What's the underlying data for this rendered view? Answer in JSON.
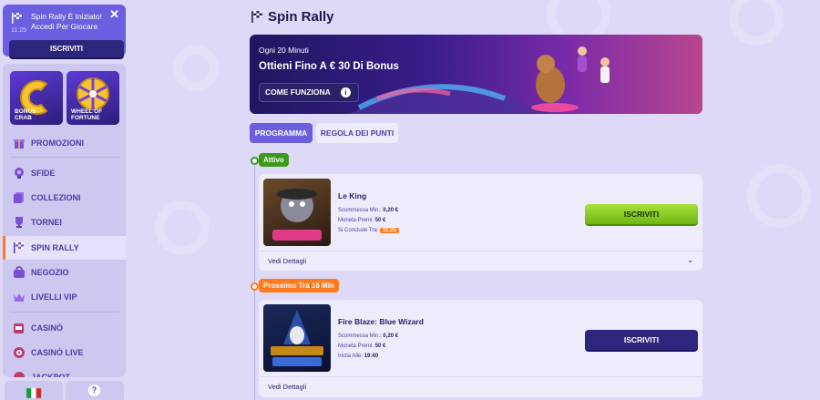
{
  "notification": {
    "message": "Spin Rally È Iniziato! Accedi Per Giocare",
    "time": "11:25",
    "button_label": "ISCRIVITI"
  },
  "sidebar": {
    "tiles": [
      {
        "label_line1": "BONUS",
        "label_line2": "CRAB",
        "icon": "crab-claw-icon"
      },
      {
        "label_line1": "WHEEL OF",
        "label_line2": "FORTUNE",
        "icon": "fortune-wheel-icon"
      }
    ],
    "items": [
      {
        "label": "PROMOZIONI",
        "icon": "gift-icon"
      },
      {
        "label": "SFIDE",
        "icon": "challenge-icon"
      },
      {
        "label": "COLLEZIONI",
        "icon": "collection-icon"
      },
      {
        "label": "TORNEI",
        "icon": "trophy-icon"
      },
      {
        "label": "SPIN RALLY",
        "icon": "checkered-flag-icon",
        "active": true
      },
      {
        "label": "NEGOZIO",
        "icon": "shop-icon"
      },
      {
        "label": "LIVELLI VIP",
        "icon": "crown-icon"
      },
      {
        "label": "CASINÒ",
        "icon": "slot-machine-icon"
      },
      {
        "label": "CASINÒ LIVE",
        "icon": "roulette-icon"
      },
      {
        "label": "JACKPOT",
        "icon": "jackpot-icon"
      }
    ],
    "footer": {
      "language_icon": "italy-flag-icon",
      "help_icon": "help-icon",
      "help_label": "?"
    }
  },
  "page": {
    "title": "Spin Rally",
    "title_icon": "checkered-flag-icon"
  },
  "hero": {
    "subtitle": "Ogni 20 Minuti",
    "headline": "Ottieni Fino A € 30 Di Bonus",
    "button_label": "COME FUNZIONA",
    "info_label": "i"
  },
  "tabs": [
    {
      "label": "PROGRAMMA",
      "active": true
    },
    {
      "label": "REGOLA DEI PUNTI",
      "active": false
    }
  ],
  "colors": {
    "accent": "#6b5fe0",
    "active_status": "#3a9a1a",
    "next_status": "#ff7a1a",
    "join_green": "#8fd12a",
    "join_dark": "#2e267d"
  },
  "rallies": [
    {
      "status": "Attivo",
      "game": "Le King",
      "rows": [
        {
          "label": "Scommessa Min.:",
          "value": "0,20 €"
        },
        {
          "label": "Moneta Premi:",
          "value": "50 €"
        },
        {
          "label": "Si Conclude Tra:",
          "value": "11:25"
        }
      ],
      "button_label": "ISCRIVITI",
      "details_label": "Vedi Dettagli"
    },
    {
      "status": "Prossimo Tra 16 Min",
      "game": "Fire Blaze: Blue Wizard",
      "rows": [
        {
          "label": "Scommessa Min.:",
          "value": "0,20 €"
        },
        {
          "label": "Moneta Premi:",
          "value": "50 €"
        },
        {
          "label": "Inizia Alle:",
          "value": "19:40"
        }
      ],
      "button_label": "ISCRIVITI",
      "details_label": "Vedi Dettagli"
    }
  ]
}
